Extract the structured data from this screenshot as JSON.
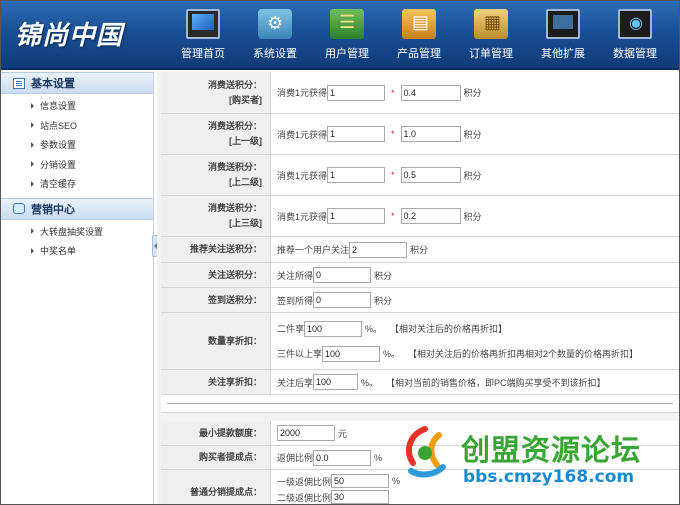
{
  "header": {
    "logo": "锦尚中国",
    "nav": [
      {
        "label": "管理首页",
        "icon": "monitor-icon"
      },
      {
        "label": "系统设置",
        "icon": "tools-icon"
      },
      {
        "label": "用户管理",
        "icon": "users-icon"
      },
      {
        "label": "产品管理",
        "icon": "product-icon"
      },
      {
        "label": "订单管理",
        "icon": "order-icon"
      },
      {
        "label": "其他扩展",
        "icon": "extension-icon"
      },
      {
        "label": "数据管理",
        "icon": "data-icon"
      }
    ]
  },
  "sidebar": {
    "sections": [
      {
        "title": "基本设置",
        "items": [
          "信息设置",
          "站点SEO",
          "参数设置",
          "分销设置",
          "清空缓存"
        ]
      },
      {
        "title": "营销中心",
        "items": [
          "大转盘抽奖设置",
          "中奖名单"
        ]
      }
    ]
  },
  "form": {
    "points_buyer": {
      "label": "消费送积分：",
      "sub": "[购买者]",
      "prefix": "消费1元获得",
      "value1": "1",
      "value2": "0.4",
      "unit": "积分"
    },
    "points_level1": {
      "label": "消费送积分：",
      "sub": "[上一级]",
      "prefix": "消费1元获得",
      "value1": "1",
      "value2": "1.0",
      "unit": "积分"
    },
    "points_level2": {
      "label": "消费送积分：",
      "sub": "[上二级]",
      "prefix": "消费1元获得",
      "value1": "1",
      "value2": "0.5",
      "unit": "积分"
    },
    "points_level3": {
      "label": "消费送积分：",
      "sub": "[上三级]",
      "prefix": "消费1元获得",
      "value1": "1",
      "value2": "0.2",
      "unit": "积分"
    },
    "star": "*",
    "referral": {
      "label": "推荐关注送积分：",
      "prefix": "推荐一个用户关注",
      "value": "2",
      "unit": "积分"
    },
    "follow": {
      "label": "关注送积分：",
      "prefix": "关注所得",
      "value": "0",
      "unit": "积分"
    },
    "signin": {
      "label": "签到送积分：",
      "prefix": "签到所得",
      "value": "0",
      "unit": "积分"
    },
    "quantity_discount": {
      "label": "数量享折扣：",
      "line1": {
        "prefix": "二件享",
        "value": "100",
        "unit": "%。",
        "note": "【相对关注后的价格再折扣】"
      },
      "line2": {
        "prefix": "三件以上享",
        "value": "100",
        "unit": "%。",
        "note": "【相对关注后的价格再折扣再相对2个数量的价格再折扣】"
      }
    },
    "follow_discount": {
      "label": "关注享折扣：",
      "prefix": "关注后享",
      "value": "100",
      "unit": "%。",
      "note": "【相对当前的销售价格，即PC端购买享受不到该折扣】"
    },
    "min_withdraw": {
      "label": "最小提款额度：",
      "value": "2000",
      "unit": "元"
    },
    "buyer_commission": {
      "label": "购买者提成点：",
      "prefix": "返佣比例",
      "value": "0.0",
      "unit": "%"
    },
    "distribution_commission": {
      "label": "普通分销提成点：",
      "line1": {
        "prefix": "一级返佣比例",
        "value": "50",
        "unit": "%"
      },
      "line2": {
        "prefix": "二级返佣比例",
        "value": "30"
      }
    }
  },
  "watermark": {
    "cn": "创盟资源论坛",
    "url": "bbs.cmzy168.com"
  },
  "colors": {
    "header": "#1a4f96",
    "accent": "#3aa535",
    "url": "#1a8ad0"
  }
}
